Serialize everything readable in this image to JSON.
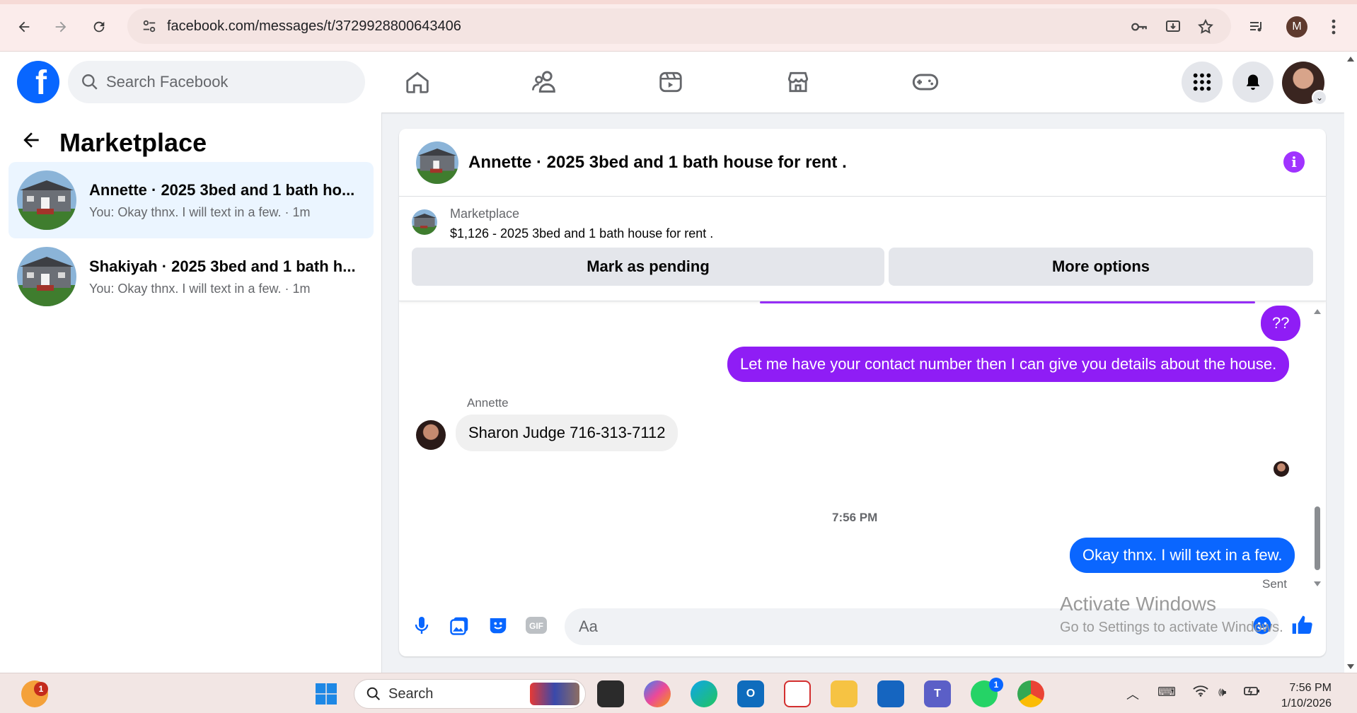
{
  "browser": {
    "url": "facebook.com/messages/t/3729928800643406",
    "profile_initial": "M"
  },
  "facebook": {
    "search_placeholder": "Search Facebook",
    "nav": [
      "home-icon",
      "friends-icon",
      "video-icon",
      "marketplace-icon",
      "gaming-icon"
    ]
  },
  "sidebar": {
    "title": "Marketplace",
    "conversations": [
      {
        "title": "Annette · 2025 3bed and 1 bath ho...",
        "preview": "You: Okay thnx. I will text in a few. · 1m",
        "active": true
      },
      {
        "title": "Shakiyah · 2025 3bed and 1 bath h...",
        "preview": "You: Okay thnx. I will text in a few. · 1m",
        "active": false
      }
    ]
  },
  "chat": {
    "title": "Annette · 2025 3bed and 1 bath house for rent .",
    "listing": {
      "category": "Marketplace",
      "price_title": "$1,126 - 2025 3bed and 1 bath house for rent .",
      "mark_pending": "Mark as pending",
      "more_options": "More options"
    },
    "messages": {
      "m1": "??",
      "m2": "Let me have your contact number then I can give you details about the house.",
      "sender_name": "Annette",
      "m3": "Sharon Judge 716-313-7112",
      "timestamp": "7:56 PM",
      "m4": "Okay thnx. I will text in a few.",
      "status": "Sent"
    },
    "composer_placeholder": "Aa"
  },
  "watermark": {
    "line1": "Activate Windows",
    "line2": "Go to Settings to activate Windows."
  },
  "taskbar": {
    "search_label": "Search",
    "time": "7:56 PM",
    "date": "1/10/2026",
    "notif_badge": "1",
    "whatsapp_badge": "1"
  },
  "colors": {
    "fb_blue": "#0866ff",
    "outgoing_purple": "#8f1df5",
    "outgoing_blue": "#0a66ff"
  }
}
